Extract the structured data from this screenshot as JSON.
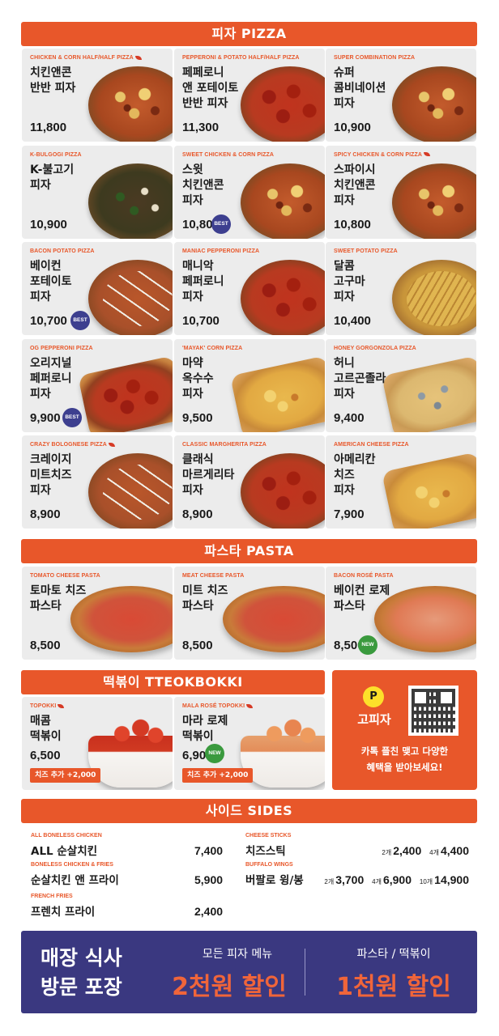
{
  "sections": {
    "pizza": "피자 PIZZA",
    "pasta": "파스타 PASTA",
    "tteokbokki": "떡볶이 TTEOKBOKKI",
    "sides": "사이드 SIDES"
  },
  "pizzas": [
    {
      "en": "CHICKEN & CORN HALF/HALF PIZZA",
      "ko": [
        "치킨앤콘",
        "반반 피자"
      ],
      "price": "11,800",
      "spicy": true
    },
    {
      "en": "PEPPERONI & POTATO HALF/HALF PIZZA",
      "ko": [
        "페페로니",
        "앤 포테이토",
        "반반 피자"
      ],
      "price": "11,300"
    },
    {
      "en": "SUPER COMBINATION PIZZA",
      "ko": [
        "슈퍼",
        "콤비네이션",
        "피자"
      ],
      "price": "10,900"
    },
    {
      "en": "K-BULGOGI PIZZA",
      "ko": [
        "K-불고기",
        "피자"
      ],
      "price": "10,900"
    },
    {
      "en": "SWEET CHICKEN & CORN PIZZA",
      "ko": [
        "스윗",
        "치킨앤콘",
        "피자"
      ],
      "price": "10,800",
      "badge": "BEST"
    },
    {
      "en": "SPICY CHICKEN & CORN PIZZA",
      "ko": [
        "스파이시",
        "치킨앤콘",
        "피자"
      ],
      "price": "10,800",
      "spicy": true
    },
    {
      "en": "BACON POTATO PIZZA",
      "ko": [
        "베이컨",
        "포테이토",
        "피자"
      ],
      "price": "10,700",
      "badge": "BEST"
    },
    {
      "en": "MANIAC PEPPERONI PIZZA",
      "ko": [
        "매니악",
        "페퍼로니",
        "피자"
      ],
      "price": "10,700"
    },
    {
      "en": "SWEET POTATO PIZZA",
      "ko": [
        "달콤",
        "고구마",
        "피자"
      ],
      "price": "10,400"
    },
    {
      "en": "OG PEPPERONI PIZZA",
      "ko": [
        "오리지널",
        "페퍼로니",
        "피자"
      ],
      "price": "9,900",
      "badge": "BEST"
    },
    {
      "en": "'MAYAK' CORN PIZZA",
      "ko": [
        "마약",
        "옥수수",
        "피자"
      ],
      "price": "9,500"
    },
    {
      "en": "HONEY GORGONZOLA PIZZA",
      "ko": [
        "허니",
        "고르곤졸라",
        "피자"
      ],
      "price": "9,400"
    },
    {
      "en": "CRAZY BOLOGNESE PIZZA",
      "ko": [
        "크레이지",
        "미트치즈",
        "피자"
      ],
      "price": "8,900",
      "spicy": true
    },
    {
      "en": "CLASSIC MARGHERITA PIZZA",
      "ko": [
        "클래식",
        "마르게리타",
        "피자"
      ],
      "price": "8,900"
    },
    {
      "en": "AMERICAN CHEESE PIZZA",
      "ko": [
        "아메리칸",
        "치즈",
        "피자"
      ],
      "price": "7,900"
    }
  ],
  "pastas": [
    {
      "en": "TOMATO CHEESE PASTA",
      "ko": [
        "토마토 치즈",
        "파스타"
      ],
      "price": "8,500"
    },
    {
      "en": "MEAT CHEESE PASTA",
      "ko": [
        "미트 치즈",
        "파스타"
      ],
      "price": "8,500"
    },
    {
      "en": "BACON ROSÉ PASTA",
      "ko": [
        "베이컨 로제",
        "파스타"
      ],
      "price": "8,500",
      "badge": "NEW"
    }
  ],
  "tteokbokki": [
    {
      "en": "TOPOKKI",
      "ko": [
        "매콤",
        "떡볶이"
      ],
      "price": "6,500",
      "addon": "치즈 추가 +2,000",
      "spicy": true
    },
    {
      "en": "MALA ROSÉ TOPOKKI",
      "ko": [
        "마라 로제",
        "떡볶이"
      ],
      "price": "6,900",
      "addon": "치즈 추가 +2,000",
      "badge": "NEW",
      "spicy": true
    }
  ],
  "promo": {
    "logo_letter": "P",
    "logo_text": "고피자",
    "line1": "카톡 플친 맺고 다양한",
    "line2": "혜택을 받아보세요!"
  },
  "sides": {
    "left": [
      {
        "en": "ALL BONELESS CHICKEN",
        "ko": "ALL 순살치킨",
        "price": "7,400"
      },
      {
        "en": "BONELESS CHICKEN & FRIES",
        "ko": "순살치킨 앤 프라이",
        "price": "5,900"
      },
      {
        "en": "FRENCH FRIES",
        "ko": "프렌치 프라이",
        "price": "2,400"
      }
    ],
    "cheese_sticks": {
      "en": "CHEESE STICKS",
      "ko": "치즈스틱",
      "q1": "2개",
      "p1": "2,400",
      "q2": "4개",
      "p2": "4,400"
    },
    "buffalo_wings": {
      "en": "BUFFALO WINGS",
      "ko": "버팔로 윙/봉",
      "q1": "2개",
      "p1": "3,700",
      "q2": "4개",
      "p2": "6,900",
      "q3": "10개",
      "p3": "14,900"
    }
  },
  "banner": {
    "left_line1": "매장 식사",
    "left_line2": "방문 포장",
    "mid_sub": "모든 피자 메뉴",
    "mid_big": "2천원 할인",
    "right_sub": "파스타 / 떡볶이",
    "right_big": "1천원 할인"
  },
  "colors": {
    "accent": "#e8572a",
    "banner": "#3a3880",
    "best_badge": "#3d3f8f",
    "new_badge": "#3a9a3e",
    "logo_yellow": "#fde02a"
  }
}
